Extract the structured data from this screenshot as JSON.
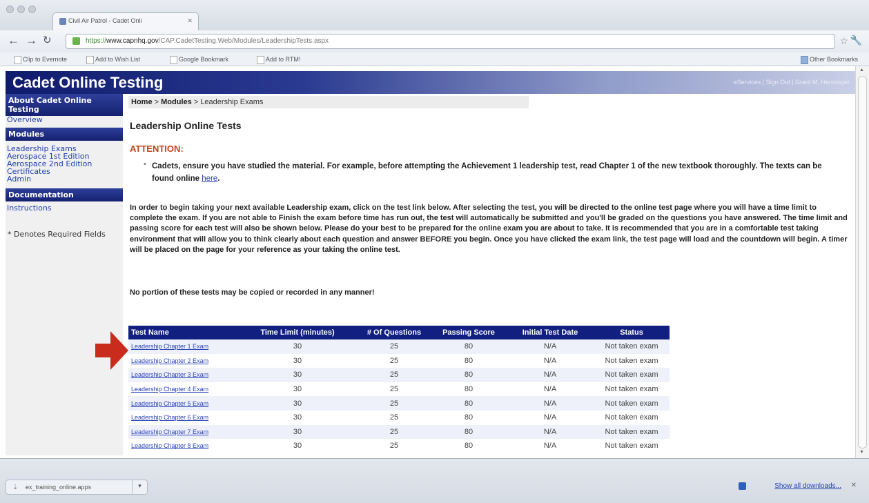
{
  "browser": {
    "tab_title": "Civil Air Patrol - Cadet Onli",
    "url_scheme": "https://",
    "url_domain": "www.capnhq.gov",
    "url_path": "/CAP.CadetTesting.Web/Modules/LeadershipTests.aspx",
    "bookmarks": [
      "Clip to Evernote",
      "Add to Wish List",
      "Google Bookmark",
      "Add to RTM!"
    ],
    "other_bookmarks": "Other Bookmarks"
  },
  "banner": {
    "title": "Cadet Online Testing",
    "links": [
      "eServices",
      "Sign Out",
      "Grant M. Henninger"
    ]
  },
  "sidebar": {
    "about_heading": "About Cadet Online Testing",
    "about_links": [
      "Overview"
    ],
    "modules_heading": "Modules",
    "modules_links": [
      "Leadership Exams",
      "Aerospace 1st Edition",
      "Aerospace 2nd Edition",
      "Certificates",
      "Admin"
    ],
    "documentation_heading": "Documentation",
    "documentation_links": [
      "Instructions"
    ],
    "required_note": "* Denotes Required Fields"
  },
  "breadcrumb": {
    "home": "Home",
    "sep": ">",
    "modules": "Modules",
    "current": "Leadership Exams"
  },
  "main": {
    "heading": "Leadership Online Tests",
    "attention_label": "ATTENTION:",
    "bullet_text": "Cadets, ensure you have studied the material. For example, before attempting the Achievement 1 leadership test, read Chapter 1 of the new textbook thoroughly. The texts can be found online ",
    "bullet_link": "here",
    "bullet_end": ".",
    "paragraph": "In order to begin taking your next available Leadership exam, click on the test link below. After selecting the test, you will be directed to the online test page where you will have a time limit to complete the exam. If you are not able to Finish the exam before time has run out, the test will automatically be submitted and you'll be graded on the questions you have answered. The time limit and passing score for each test will also be shown below. Please do your best to be prepared for the online exam you are about to take. It is recommended that you are in a comfortable test taking environment that will allow you to think clearly about each question and answer BEFORE you begin. Once you have clicked the exam link, the test page will load and the countdown will begin. A timer will be placed on the page for your reference as your taking the online test.",
    "warning": "No portion of these tests may be copied or recorded in any manner!"
  },
  "table": {
    "columns": [
      "Test Name",
      "Time Limit (minutes)",
      "# Of Questions",
      "Passing Score",
      "Initial Test Date",
      "Status"
    ],
    "rows": [
      {
        "name": "Leadership Chapter 1 Exam",
        "time": "30",
        "questions": "25",
        "score": "80",
        "date": "N/A",
        "status": "Not taken exam"
      },
      {
        "name": "Leadership Chapter 2 Exam",
        "time": "30",
        "questions": "25",
        "score": "80",
        "date": "N/A",
        "status": "Not taken exam"
      },
      {
        "name": "Leadership Chapter 3 Exam",
        "time": "30",
        "questions": "25",
        "score": "80",
        "date": "N/A",
        "status": "Not taken exam"
      },
      {
        "name": "Leadership Chapter 4 Exam",
        "time": "30",
        "questions": "25",
        "score": "80",
        "date": "N/A",
        "status": "Not taken exam"
      },
      {
        "name": "Leadership Chapter 5 Exam",
        "time": "30",
        "questions": "25",
        "score": "80",
        "date": "N/A",
        "status": "Not taken exam"
      },
      {
        "name": "Leadership Chapter 6 Exam",
        "time": "30",
        "questions": "25",
        "score": "80",
        "date": "N/A",
        "status": "Not taken exam"
      },
      {
        "name": "Leadership Chapter 7 Exam",
        "time": "30",
        "questions": "25",
        "score": "80",
        "date": "N/A",
        "status": "Not taken exam"
      },
      {
        "name": "Leadership Chapter 8 Exam",
        "time": "30",
        "questions": "25",
        "score": "80",
        "date": "N/A",
        "status": "Not taken exam"
      }
    ]
  },
  "download_bar": {
    "file": "ex_training_online.apps",
    "show_all": "Show all downloads..."
  },
  "colors": {
    "banner_dark": "#0f1b6d",
    "table_header": "#111f80",
    "attention": "#c0441e",
    "link": "#2b45b8",
    "arrow": "#c92b1c"
  }
}
